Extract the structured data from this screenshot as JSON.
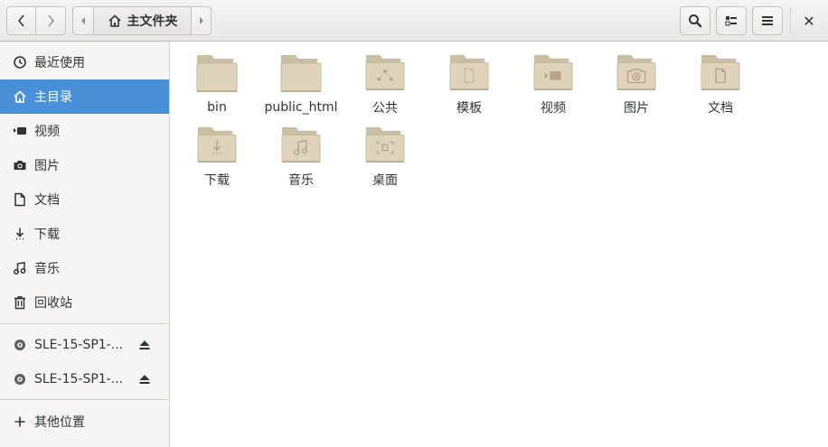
{
  "header": {
    "breadcrumb_label": "主文件夹",
    "back_icon": "chevron-left-icon",
    "forward_icon": "chevron-right-icon",
    "search_icon": "search-icon",
    "view_icon": "list-view-icon",
    "menu_icon": "hamburger-menu-icon",
    "close_label": "✕"
  },
  "sidebar": {
    "items": [
      {
        "label": "最近使用",
        "icon": "recent-clock-icon"
      },
      {
        "label": "主目录",
        "icon": "home-icon",
        "active": true
      },
      {
        "label": "视频",
        "icon": "video-icon"
      },
      {
        "label": "图片",
        "icon": "camera-icon"
      },
      {
        "label": "文档",
        "icon": "document-icon"
      },
      {
        "label": "下载",
        "icon": "download-icon"
      },
      {
        "label": "音乐",
        "icon": "music-icon"
      },
      {
        "label": "回收站",
        "icon": "trash-icon"
      }
    ],
    "devices": [
      {
        "label": "SLE-15-SP1-...",
        "icon": "disc-icon"
      },
      {
        "label": "SLE-15-SP1-...",
        "icon": "disc-icon"
      }
    ],
    "other_locations": {
      "label": "其他位置",
      "icon": "plus-icon"
    }
  },
  "files": [
    {
      "name": "bin",
      "emblem": "none"
    },
    {
      "name": "public_html",
      "emblem": "none"
    },
    {
      "name": "公共",
      "emblem": "share"
    },
    {
      "name": "模板",
      "emblem": "template"
    },
    {
      "name": "视频",
      "emblem": "video"
    },
    {
      "name": "图片",
      "emblem": "camera"
    },
    {
      "name": "文档",
      "emblem": "document"
    },
    {
      "name": "下载",
      "emblem": "download"
    },
    {
      "name": "音乐",
      "emblem": "music"
    },
    {
      "name": "桌面",
      "emblem": "desktop"
    }
  ],
  "colors": {
    "accent": "#4a90d9",
    "folder_fill": "#dfd3bb",
    "folder_tab": "#cbbd9f"
  }
}
